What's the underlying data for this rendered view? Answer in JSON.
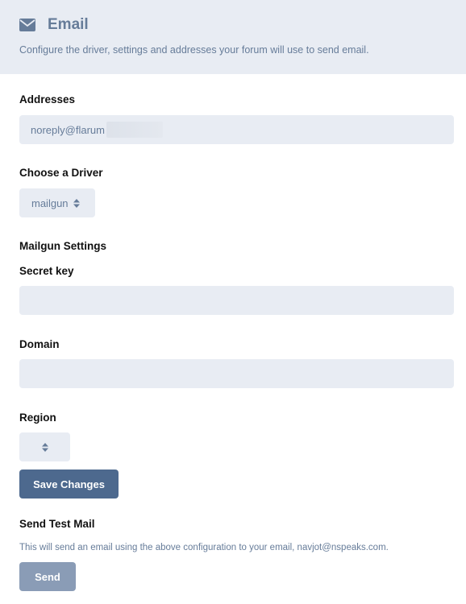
{
  "header": {
    "title": "Email",
    "description": "Configure the driver, settings and addresses your forum will use to send email."
  },
  "addresses": {
    "label": "Addresses",
    "value": "noreply@flarum"
  },
  "driver": {
    "label": "Choose a Driver",
    "selected": "mailgun"
  },
  "mailgun": {
    "section_title": "Mailgun Settings",
    "secret_key_label": "Secret key",
    "secret_key_value": "",
    "domain_label": "Domain",
    "domain_value": "",
    "region_label": "Region",
    "region_selected": ""
  },
  "actions": {
    "save_label": "Save Changes"
  },
  "test_mail": {
    "section_title": "Send Test Mail",
    "help_text": "This will send an email using the above configuration to your email, navjot@nspeaks.com.",
    "send_label": "Send"
  },
  "colors": {
    "header_bg": "#e8ecf3",
    "accent": "#4d698e",
    "muted_text": "#667c99",
    "disabled_button": "#8a9cb6"
  },
  "icons": {
    "header": "envelope-icon",
    "select_caret": "sort-caret-icon"
  }
}
